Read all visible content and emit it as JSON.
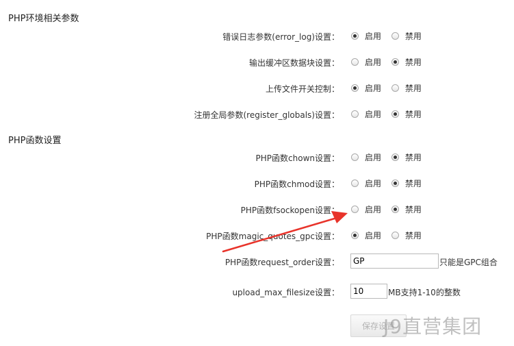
{
  "sections": {
    "env_title": "PHP环境相关参数",
    "func_title": "PHP函数设置"
  },
  "options": {
    "enable": "启用",
    "disable": "禁用"
  },
  "env_rows": [
    {
      "label": "错误日志参数(error_log)设置：",
      "value": "启用"
    },
    {
      "label": "输出缓冲区数据块设置：",
      "value": "禁用"
    },
    {
      "label": "上传文件开关控制：",
      "value": "启用"
    },
    {
      "label": "注册全局参数(register_globals)设置：",
      "value": "禁用"
    }
  ],
  "func_rows": [
    {
      "label": "PHP函数chown设置：",
      "value": "禁用"
    },
    {
      "label": "PHP函数chmod设置：",
      "value": "禁用"
    },
    {
      "label": "PHP函数fsockopen设置：",
      "value": "禁用"
    },
    {
      "label": "PHP函数magic_quotes_gpc设置：",
      "value": "启用"
    }
  ],
  "request_order": {
    "label": "PHP函数request_order设置：",
    "value": "GP",
    "hint": "只能是GPC组合"
  },
  "upload_max": {
    "label": "upload_max_filesize设置：",
    "value": "10",
    "hint": "MB支持1-10的整数"
  },
  "save_label": "保存设置",
  "watermark": "J9直营集团",
  "colors": {
    "arrow": "#e8332a",
    "text": "#333333",
    "button_text": "#b3b3b3"
  }
}
